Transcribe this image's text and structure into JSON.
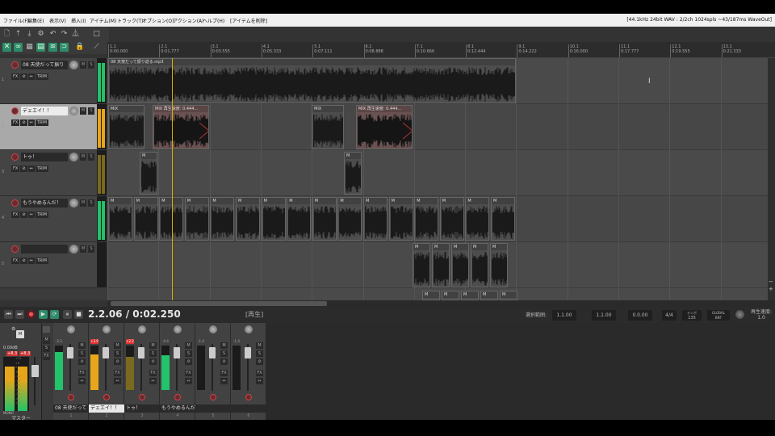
{
  "menu": [
    "ファイル(F)",
    "編集(E)",
    "表示(V)",
    "挿入(I)",
    "アイテム(M)",
    "トラック(T)",
    "オプション(O)",
    "アクション(A)",
    "ヘルプ(H)",
    "[アイテムを削除]"
  ],
  "status_info": "[44.1kHz 24bit WAV : 2/2ch 1024spls ~43/187ms WaveOut]",
  "ruler": [
    {
      "bar": "1.1",
      "time": "0:00.000"
    },
    {
      "bar": "2.1",
      "time": "0:01.777"
    },
    {
      "bar": "3.1",
      "time": "0:03.555"
    },
    {
      "bar": "4.1",
      "time": "0:05.333"
    },
    {
      "bar": "5.1",
      "time": "0:07.111"
    },
    {
      "bar": "6.1",
      "time": "0:08.888"
    },
    {
      "bar": "7.1",
      "time": "0:10.666"
    },
    {
      "bar": "8.1",
      "time": "0:12.444"
    },
    {
      "bar": "9.1",
      "time": "0:14.222"
    },
    {
      "bar": "10.1",
      "time": "0:16.000"
    },
    {
      "bar": "11.1",
      "time": "0:17.777"
    },
    {
      "bar": "12.1",
      "time": "0:19.555"
    },
    {
      "bar": "13.1",
      "time": "0:21.333"
    }
  ],
  "tracks": [
    {
      "num": "1",
      "name": "08 天使だって振り",
      "selected": false
    },
    {
      "num": "2",
      "name": "デェエイ！！",
      "selected": true
    },
    {
      "num": "3",
      "name": "トゥ！",
      "selected": false
    },
    {
      "num": "4",
      "name": "もうやめるんだ！",
      "selected": false
    },
    {
      "num": "5",
      "name": "",
      "selected": false
    }
  ],
  "track_buttons": {
    "fx": "FX",
    "trim": "TRIM",
    "m": "M",
    "s": "S"
  },
  "items": {
    "track1": "08 天使だって振り返る.mp3",
    "mix_label": "MIX",
    "m_label": "M",
    "play_label": "再生",
    "playrate_item": "再生速度: 0.444..."
  },
  "transport": {
    "time": "2.2.06 / 0:02.250",
    "state": "[再生]",
    "selection_label": "選択範囲:",
    "sel_start": "1.1.00",
    "sel_end": "1.1.00",
    "sel_len": "0.0.00",
    "timesig": "4/4",
    "tempo_label": "テンポ",
    "tempo": "135",
    "global_label": "GLOBAL",
    "global_mode": "BNT",
    "playrate_label": "再生速度:",
    "playrate": "1.0"
  },
  "mixer": {
    "master_label": "マスター",
    "master_vol": "0.00dB",
    "master_peaks": [
      "+8.3",
      "+8.3"
    ],
    "mono": "MONO",
    "master_scale": [
      "+12",
      "+6",
      "0",
      "-6",
      "-12",
      "-18",
      "-24",
      "-30",
      "-36",
      "-42",
      "-48"
    ],
    "master_levels": [
      0.82,
      0.82
    ],
    "strips": [
      {
        "name": "08 天使だって",
        "num": "1",
        "peak": "-2.2",
        "peak_hot": false,
        "level": 0.85,
        "color": "#22c36a",
        "selected": false
      },
      {
        "name": "デェエイ！！",
        "num": "2",
        "peak": "+3.9",
        "peak_hot": true,
        "level": 0.8,
        "color": "#e7a61a",
        "selected": true
      },
      {
        "name": "トゥ！",
        "num": "3",
        "peak": "+2.2",
        "peak_hot": true,
        "level": 0.75,
        "color": "#7a6a20",
        "selected": false
      },
      {
        "name": "もうやめるんだ",
        "num": "4",
        "peak": "-4.4",
        "peak_hot": false,
        "level": 0.78,
        "color": "#22c36a",
        "selected": false
      },
      {
        "name": "",
        "num": "5",
        "peak": "-1.4",
        "peak_hot": false,
        "level": 0,
        "color": "#22c36a",
        "selected": false
      },
      {
        "name": "",
        "num": "6",
        "peak": "-1.4",
        "peak_hot": false,
        "level": 0,
        "color": "#22c36a",
        "selected": false
      }
    ]
  },
  "colors": {
    "accent": "#2e8b6a",
    "playhead": "#d8b000",
    "meter_green": "#22c36a",
    "meter_yellow": "#e7a61a",
    "rec_red": "#c44444"
  }
}
